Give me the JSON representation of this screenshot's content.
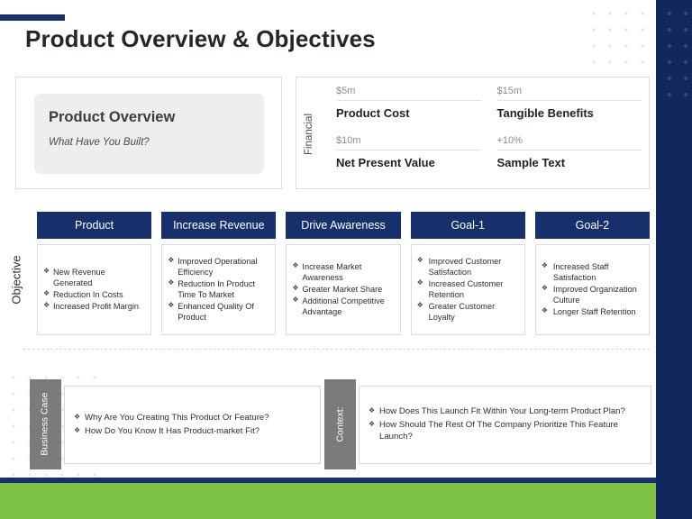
{
  "slide": {
    "title": "Product Overview & Objectives",
    "colors": {
      "navy": "#17306b",
      "navy_panel": "#11275e",
      "green": "#7dc244",
      "gray_tab": "#7b7b7b",
      "panel_gray": "#eeeeee"
    }
  },
  "overview": {
    "heading": "Product Overview",
    "subheading": "What Have You Built?"
  },
  "financial": {
    "axis_label": "Financial",
    "cells": [
      {
        "value": "$5m",
        "name": "Product Cost"
      },
      {
        "value": "$15m",
        "name": "Tangible Benefits"
      },
      {
        "value": "$10m",
        "name": "Net Present Value"
      },
      {
        "value": "+10%",
        "name": "Sample Text"
      }
    ]
  },
  "objective": {
    "axis_label": "Objective",
    "columns": [
      {
        "header": "Product",
        "bullets": [
          "New Revenue Generated",
          "Reduction In Costs",
          "Increased Profit Margin"
        ]
      },
      {
        "header": "Increase Revenue",
        "bullets": [
          "Improved Operational Efficiency",
          "Reduction In Product Time To Market",
          "Enhanced Quality Of Product"
        ]
      },
      {
        "header": "Drive Awareness",
        "bullets": [
          "Increase Market Awareness",
          "Greater Market Share",
          "Additional Competitive Advantage"
        ]
      },
      {
        "header": "Goal-1",
        "bullets": [
          "Improved Customer Satisfaction",
          "Increased Customer Retention",
          "Greater Customer Loyalty"
        ]
      },
      {
        "header": "Goal-2",
        "bullets": [
          "Increased Staff Satisfaction",
          "Improved Organization Culture",
          "Longer Staff Retention"
        ]
      }
    ]
  },
  "business_case": {
    "tab_label": "Business Case",
    "bullets": [
      "Why Are You Creating This Product Or Feature?",
      "How Do You Know It Has Product-market Fit?"
    ]
  },
  "context": {
    "tab_label": "Context:",
    "bullets": [
      "How Does This Launch Fit Within Your Long-term Product Plan?",
      "How Should The Rest Of The Company Prioritize This Feature Launch?"
    ]
  },
  "bullet_glyph": "❖"
}
